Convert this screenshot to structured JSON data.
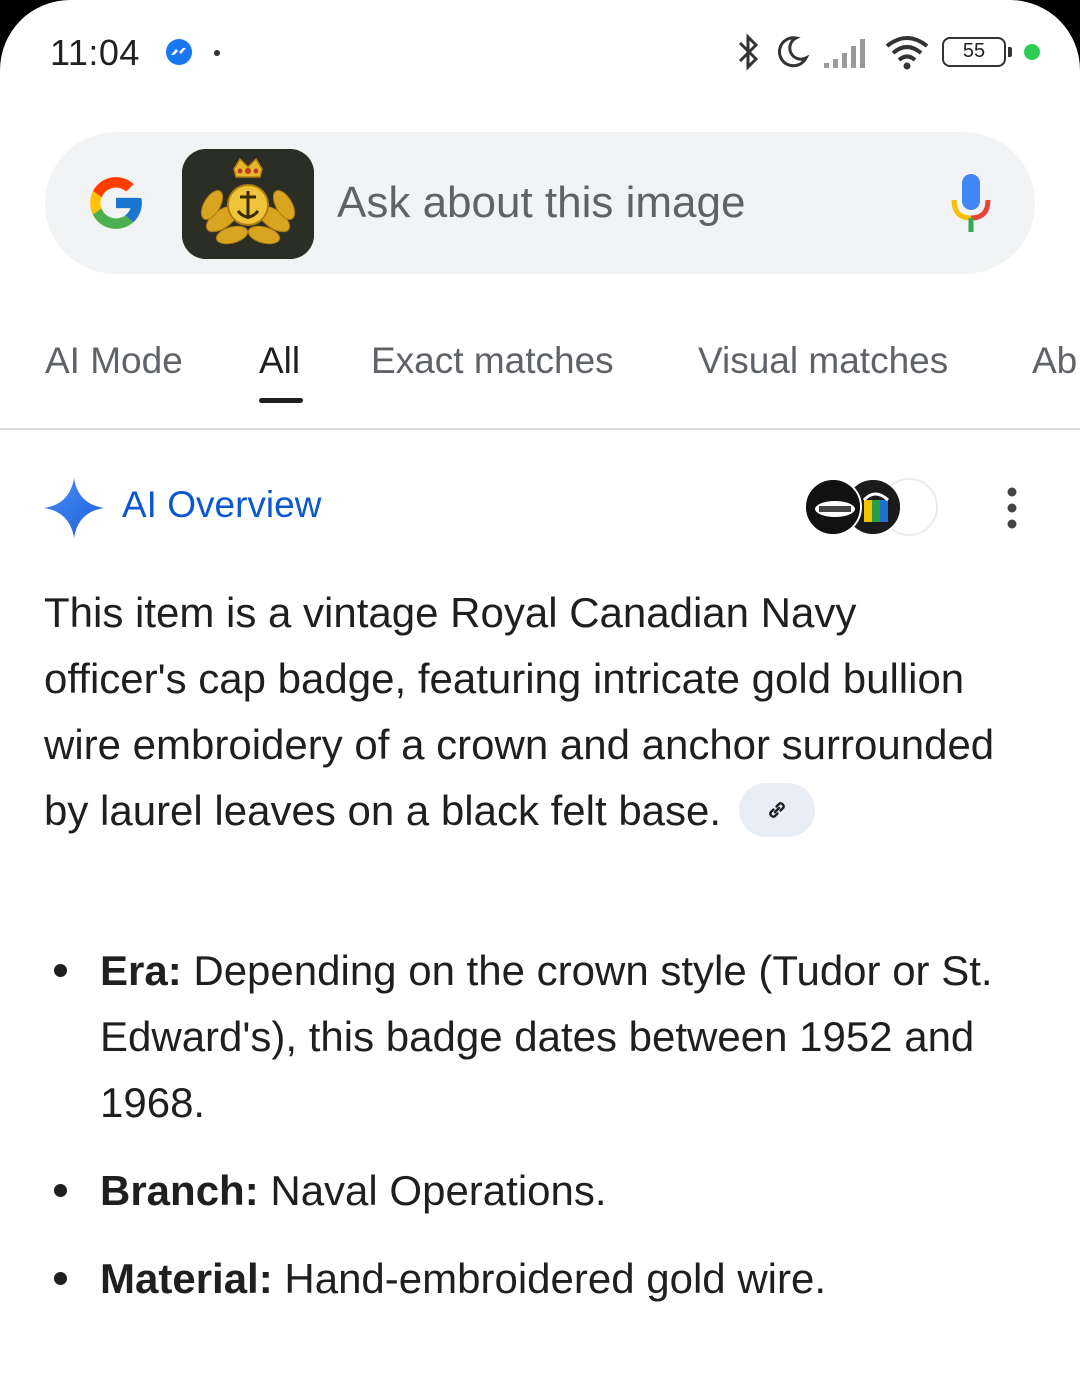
{
  "status_bar": {
    "time": "11:04",
    "battery": "55",
    "icons": [
      "messenger-icon",
      "bluetooth-icon",
      "moon-icon",
      "signal-icon",
      "wifi-icon",
      "battery-icon"
    ]
  },
  "search": {
    "placeholder": "Ask about this image",
    "logo": "google-g-logo",
    "mic_icon": "microphone-icon"
  },
  "tabs": [
    {
      "label": "AI Mode"
    },
    {
      "label": "All"
    },
    {
      "label": "Exact matches"
    },
    {
      "label": "Visual matches"
    },
    {
      "label": "Ab"
    }
  ],
  "ai_overview": {
    "title": "AI Overview",
    "summary": "This item is a vintage Royal Canadian Navy officer's cap badge, featuring intricate gold bullion wire embroidery of a crown and anchor surrounded by laurel leaves on a black felt base.",
    "bullets": [
      {
        "term": "Era:",
        "text": " Depending on the crown style (Tudor or St. Edward's), this badge dates between 1952 and 1968."
      },
      {
        "term": "Branch:",
        "text": " Naval Operations."
      },
      {
        "term": "Material:",
        "text": " Hand-embroidered gold wire."
      }
    ]
  },
  "colors": {
    "accent": "#0b57d0",
    "search_bg": "#f1f3f4",
    "chip_bg": "#e9eef6"
  }
}
